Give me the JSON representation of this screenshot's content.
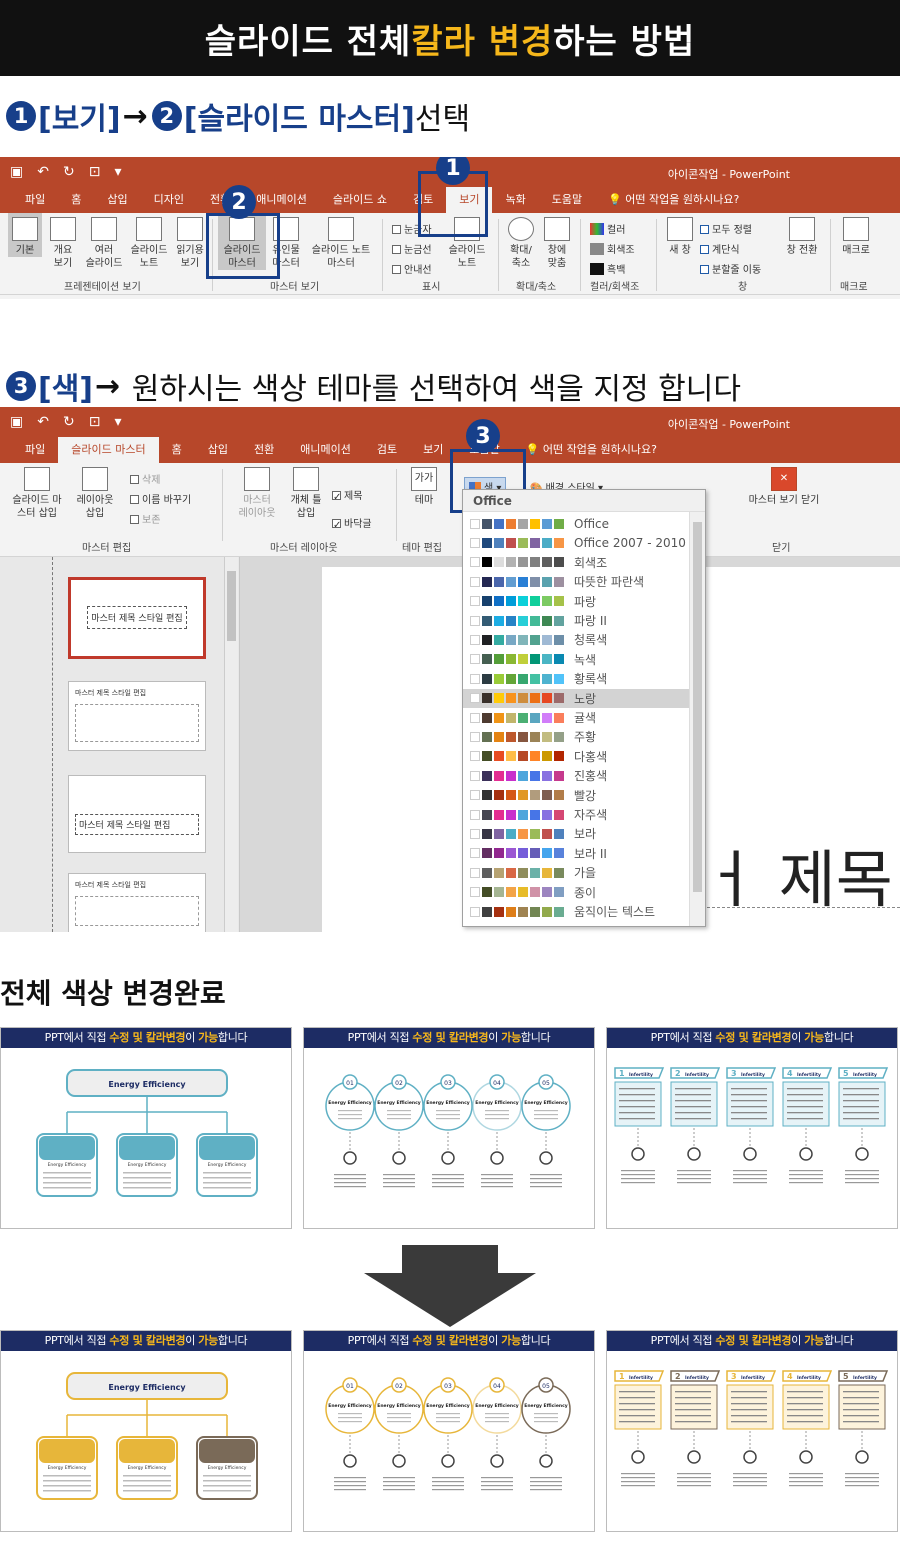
{
  "banner": {
    "part1": "슬라이드 전체 ",
    "highlight": "칼라 변경",
    "part2": "하는 방법"
  },
  "step1": {
    "n1": "1",
    "t1": "[보기]",
    "arrow": "→",
    "n2": "2",
    "t2": "[슬라이드 마스터]",
    "t3": "선택"
  },
  "step2": {
    "n3": "3",
    "t1": "[색]",
    "arrow": "→",
    "t2": " 원하시는 색상 테마를 선택하여 색을 지정 합니다"
  },
  "ppt1": {
    "app_title": "아이콘작업  -  PowerPoint",
    "tabs": [
      "파일",
      "홈",
      "삽입",
      "디자인",
      "전환",
      "애니메이션",
      "슬라이드 쇼",
      "검토",
      "보기",
      "녹화",
      "도움말"
    ],
    "tell": "어떤 작업을 원하시나요?",
    "buttons": [
      "기본",
      "개요\n보기",
      "여러\n슬라이드",
      "슬라이드\n노트",
      "읽기용\n보기",
      "슬라이드\n마스터",
      "유인물\n마스터",
      "슬라이드 노트\n마스터",
      "눈금자",
      "눈금선",
      "안내선",
      "슬라이드\n노트",
      "확대/\n축소",
      "창에\n맞춤",
      "컬러",
      "회색조",
      "흑백",
      "새 창",
      "모두 정렬",
      "계단식",
      "분할줄 이동",
      "창 전환",
      "매크로"
    ],
    "groups": [
      "프레젠테이션 보기",
      "마스터 보기",
      "표시",
      "확대/축소",
      "컬러/회색조",
      "창",
      "매크로"
    ],
    "badge1": "1",
    "badge2": "2"
  },
  "ppt2": {
    "app_title": "아이콘작업  -  PowerPoint",
    "tabs": [
      "파일",
      "슬라이드 마스터",
      "홈",
      "삽입",
      "전환",
      "애니메이션",
      "검토",
      "보기",
      "도움말"
    ],
    "tell": "어떤 작업을 원하시나요?",
    "buttons": [
      "슬라이드 마\n스터 삽입",
      "레이아웃\n삽입",
      "삭제",
      "이름 바꾸기",
      "보존",
      "마스터\n레이아웃",
      "개체 틀\n삽입",
      "제목",
      "바닥글",
      "가가",
      "테마",
      "색",
      "배경 스타일",
      "마스터 보기 닫기"
    ],
    "groups": [
      "마스터 편집",
      "마스터 레이아웃",
      "테마 편집",
      "닫기"
    ],
    "badge3": "3",
    "thumb_title": "마스터 제목 스타일 편집",
    "canvas_text": "ㅓ 제목",
    "dropdown_header": "Office",
    "themes": [
      {
        "name": "Office",
        "colors": [
          "#fff",
          "#44546a",
          "#4472c4",
          "#ed7d31",
          "#a5a5a5",
          "#ffc000",
          "#5b9bd5",
          "#70ad47"
        ]
      },
      {
        "name": "Office 2007 - 2010",
        "colors": [
          "#fff",
          "#1f497d",
          "#4f81bd",
          "#c0504d",
          "#9bbb59",
          "#8064a2",
          "#4bacc6",
          "#f79646"
        ]
      },
      {
        "name": "회색조",
        "colors": [
          "#fff",
          "#000",
          "#dddddd",
          "#b2b2b2",
          "#969696",
          "#808080",
          "#5f5f5f",
          "#4d4d4d"
        ]
      },
      {
        "name": "따뜻한 파란색",
        "colors": [
          "#fff",
          "#242852",
          "#4a66ac",
          "#629dd1",
          "#297fd5",
          "#7f8fa9",
          "#5aa2ae",
          "#9d90a0"
        ]
      },
      {
        "name": "파랑",
        "colors": [
          "#fff",
          "#17406d",
          "#0f6fc6",
          "#009dd9",
          "#0bd0d9",
          "#10cf9b",
          "#7cca62",
          "#a5c249"
        ]
      },
      {
        "name": "파랑 II",
        "colors": [
          "#fff",
          "#335b74",
          "#1cade4",
          "#2683c6",
          "#27ced7",
          "#42ba97",
          "#3e8853",
          "#62a39f"
        ]
      },
      {
        "name": "청록색",
        "colors": [
          "#fff",
          "#1f2123",
          "#34aba2",
          "#78a8c4",
          "#80b5b9",
          "#52a28f",
          "#9fb9d4",
          "#6d8fa9"
        ]
      },
      {
        "name": "녹색",
        "colors": [
          "#fff",
          "#455f51",
          "#549e39",
          "#8ab833",
          "#c0cf3a",
          "#029676",
          "#4ab5c4",
          "#0989b1"
        ]
      },
      {
        "name": "황록색",
        "colors": [
          "#fff",
          "#2c3c43",
          "#99cb38",
          "#63a537",
          "#37a76f",
          "#44c1a3",
          "#4eb3cf",
          "#51c3f9"
        ]
      },
      {
        "name": "노랑",
        "colors": [
          "#fff",
          "#39302a",
          "#ffca08",
          "#f8931d",
          "#ce8d3e",
          "#ec7016",
          "#e64823",
          "#9c6a6a"
        ]
      },
      {
        "name": "귤색",
        "colors": [
          "#fff",
          "#4e3b30",
          "#f09415",
          "#c1b56b",
          "#4baf73",
          "#5aa6c0",
          "#d17df9",
          "#fa7e5c"
        ]
      },
      {
        "name": "주황",
        "colors": [
          "#fff",
          "#637052",
          "#e48312",
          "#bd582c",
          "#865640",
          "#9b8357",
          "#c2bc80",
          "#94a088"
        ]
      },
      {
        "name": "다홍색",
        "colors": [
          "#fff",
          "#444d26",
          "#e84c22",
          "#ffbd47",
          "#b64926",
          "#ff8427",
          "#cc9900",
          "#b22600"
        ]
      },
      {
        "name": "진홍색",
        "colors": [
          "#fff",
          "#3b3059",
          "#e32d91",
          "#c830cc",
          "#4ea6dc",
          "#4775e7",
          "#8971e1",
          "#c6398d"
        ]
      },
      {
        "name": "빨강",
        "colors": [
          "#fff",
          "#323232",
          "#a5300f",
          "#d55816",
          "#e19825",
          "#b19c7d",
          "#7f5f52",
          "#b27d49"
        ]
      },
      {
        "name": "자주색",
        "colors": [
          "#fff",
          "#454551",
          "#e32d91",
          "#c830cc",
          "#4ea6dc",
          "#4775e7",
          "#8971e1",
          "#d54773"
        ]
      },
      {
        "name": "보라",
        "colors": [
          "#fff",
          "#373545",
          "#8064a2",
          "#4bacc6",
          "#f79646",
          "#9bbb59",
          "#c0504d",
          "#4f81bd"
        ]
      },
      {
        "name": "보라 II",
        "colors": [
          "#fff",
          "#632e62",
          "#92278f",
          "#9b57d3",
          "#755dd9",
          "#665eb8",
          "#45a5ed",
          "#5982db"
        ]
      },
      {
        "name": "가을",
        "colors": [
          "#fff",
          "#5e5e5e",
          "#b6a272",
          "#d96845",
          "#8f8d5c",
          "#6bb1a8",
          "#e7b63a",
          "#798a5d"
        ]
      },
      {
        "name": "종이",
        "colors": [
          "#fff",
          "#444d26",
          "#a5b592",
          "#f3a447",
          "#e7bc29",
          "#d092a7",
          "#9c85c0",
          "#809ec2"
        ]
      },
      {
        "name": "움직이는 텍스트",
        "colors": [
          "#fff",
          "#404040",
          "#a53010",
          "#de7e18",
          "#9f8351",
          "#728653",
          "#92aa4c",
          "#6aac91"
        ]
      }
    ]
  },
  "section3": "전체 색상 변경완료",
  "cards": {
    "header_a": "PPT에서 직접 ",
    "header_h1": "수정 및 칼라변경",
    "header_b": "이 ",
    "header_h2": "가능",
    "header_c": "합니다",
    "energy": "Energy Efficiency",
    "energy_short": "Energy\nEfficiency",
    "steps": [
      "01",
      "02",
      "03",
      "04",
      "05"
    ],
    "infertility": "Infertility",
    "nums": [
      "1",
      "2",
      "3",
      "4",
      "5"
    ]
  },
  "colors": {
    "accent": "#b7472a",
    "brand": "#173f8a",
    "highlight": "#f6b71b",
    "before": "#5fb0c4",
    "after": "#e7b63a",
    "after_dark": "#7a6a58"
  }
}
